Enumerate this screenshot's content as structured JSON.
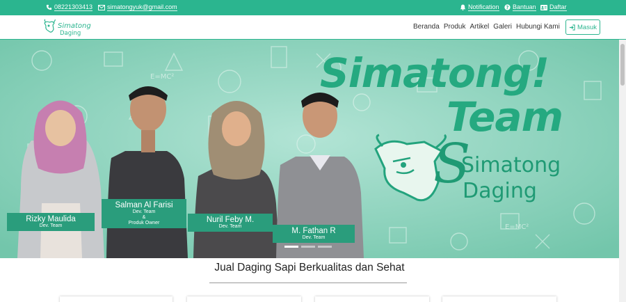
{
  "topbar": {
    "phone": "08221303413",
    "email": "simatongyuk@gmail.com",
    "notification": "Notification",
    "help": "Bantuan",
    "register": "Daftar"
  },
  "nav": {
    "brand_line1": "Simatong",
    "brand_line2": "Daging",
    "menu": [
      "Beranda",
      "Produk",
      "Artikel",
      "Galeri",
      "Hubungi Kami"
    ],
    "login": "Masuk"
  },
  "hero": {
    "title_line1": "Simatong!",
    "title_line2": "Team",
    "logo_line1": "Simatong",
    "logo_line2": "Daging",
    "formula": "E=MC²",
    "team": [
      {
        "name": "Rizky Maulida",
        "role": "Dev. Team"
      },
      {
        "name": "Salman Al Farisi",
        "role": "Dev. Team",
        "role2": "&",
        "role3": "Produk Owner"
      },
      {
        "name": "Nuril Feby M.",
        "role": "Dev. Team"
      },
      {
        "name": "M. Fathan R",
        "role": "Dev. Team"
      }
    ]
  },
  "section": {
    "title": "Jual Daging Sapi Berkualitas dan Sehat"
  },
  "colors": {
    "primary": "#2bb58f",
    "hero_bg": "#8bd3bd",
    "hero_text": "#25a980"
  }
}
